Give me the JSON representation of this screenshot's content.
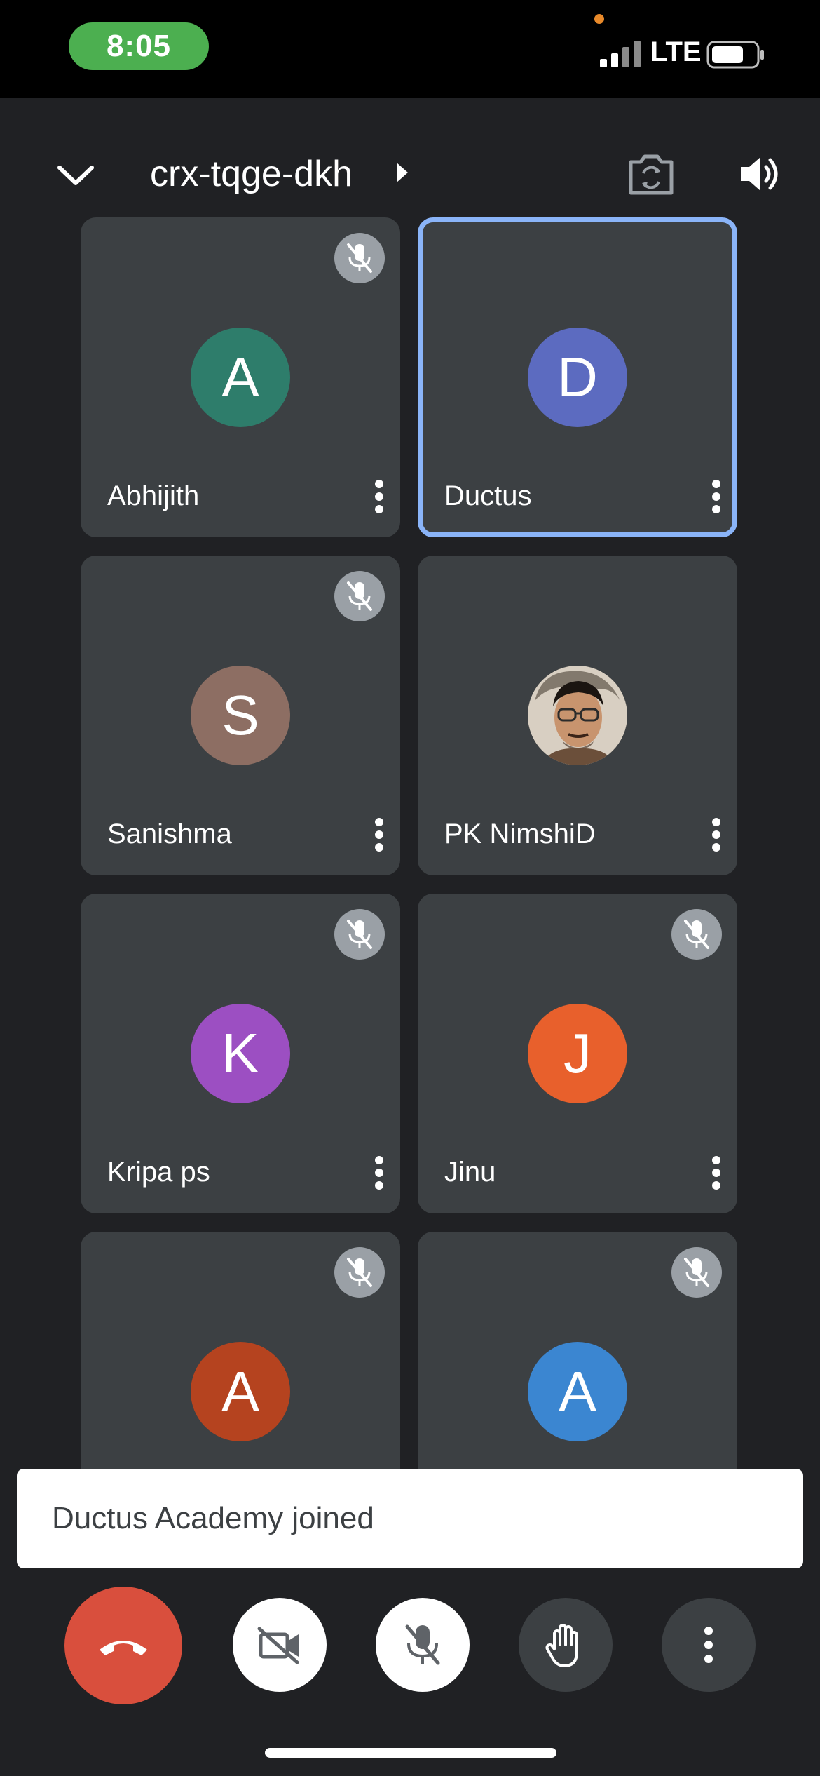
{
  "status_bar": {
    "time": "8:05",
    "network": "LTE",
    "colors": {
      "time_pill": "#4caf50",
      "camera_dot": "#e8892a"
    }
  },
  "top_bar": {
    "meeting_code": "crx-tqge-dkh",
    "icons": [
      "chevron-down-icon",
      "caret-right-icon",
      "switch-camera-icon",
      "speaker-icon"
    ]
  },
  "participants": [
    {
      "name": "Abhijith",
      "initial": "A",
      "avatar_color": "#2e7d6b",
      "muted": true,
      "active": false
    },
    {
      "name": "Ductus",
      "initial": "D",
      "avatar_color": "#5c6bc0",
      "muted": false,
      "active": true
    },
    {
      "name": "Sanishma",
      "initial": "S",
      "avatar_color": "#8d6e63",
      "muted": true,
      "active": false
    },
    {
      "name": "PK NimshiD",
      "initial": "",
      "avatar_color": "#c9b9a6",
      "muted": false,
      "active": false,
      "photo": true
    },
    {
      "name": "Kripa ps",
      "initial": "K",
      "avatar_color": "#9c4fc2",
      "muted": true,
      "active": false
    },
    {
      "name": "Jinu",
      "initial": "J",
      "avatar_color": "#e8602c",
      "muted": true,
      "active": false
    },
    {
      "name": "",
      "initial": "A",
      "avatar_color": "#b5431f",
      "muted": true,
      "active": false
    },
    {
      "name": "",
      "initial": "A",
      "avatar_color": "#3b86d1",
      "muted": true,
      "active": false
    }
  ],
  "toast": {
    "message": "Ductus Academy joined"
  },
  "controls": {
    "items": [
      "end-call-icon",
      "camera-off-icon",
      "mic-off-icon",
      "raise-hand-icon",
      "more-options-icon"
    ],
    "colors": {
      "end_call": "#d94f3d",
      "toggle_on": "#ffffff",
      "neutral": "#3c4043"
    }
  },
  "theme": {
    "background": "#202124",
    "tile": "#3c4043",
    "active_border": "#8ab4f8",
    "mute_badge": "#9aa0a6"
  }
}
